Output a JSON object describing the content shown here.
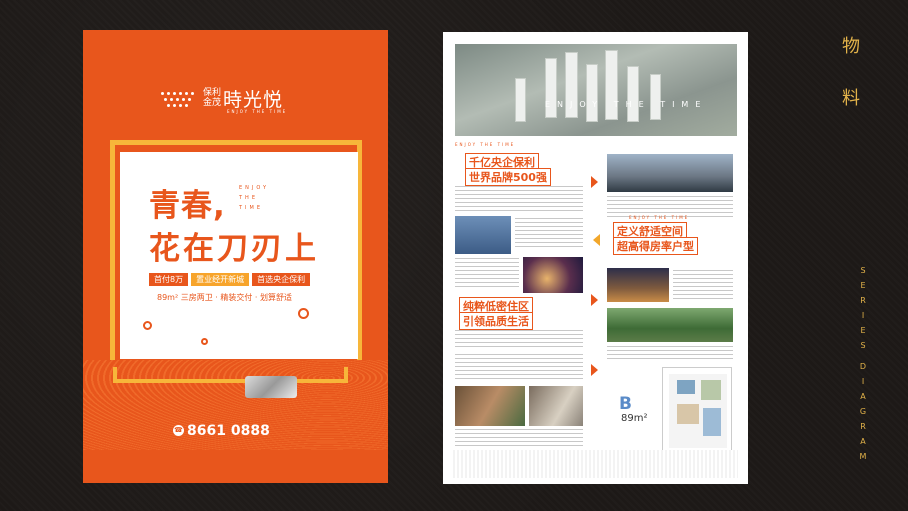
{
  "labels": {
    "cn_1": "物",
    "cn_2": "料",
    "en_letters": [
      "S",
      "E",
      "R",
      "I",
      "E",
      "S",
      "D",
      "I",
      "A",
      "G",
      "R",
      "A",
      "M"
    ]
  },
  "poster_left": {
    "brand_cn_small": "保利 金茂",
    "brand_cn_large": "時光悦",
    "brand_en": "ENJOY THE TIME",
    "headline_1": "青春,",
    "headline_2": "花在刀刃上",
    "enjoy_vertical": "ENJOY THE TIME",
    "promo_1": "首付8万",
    "promo_2": "置业经开新城",
    "promo_3": "首选央企保利",
    "spec": "89m² 三房两卫 · 精装交付 · 划算舒适",
    "phone": "8661 0888"
  },
  "poster_right": {
    "enjoy": "ENJOY THE TIME",
    "heading_1a": "千亿央企保利",
    "heading_1b": "世界品牌500强",
    "heading_2a": "定义舒适空间",
    "heading_2b": "超高得房率户型",
    "heading_3a": "纯粹低密住区",
    "heading_3b": "引领品质生活",
    "unit_mark": "B",
    "unit_area": "89m²"
  },
  "colors": {
    "orange": "#e8561c",
    "yellow": "#f7b63a",
    "gold": "#e3b34a",
    "blue": "#5a8bc8"
  }
}
